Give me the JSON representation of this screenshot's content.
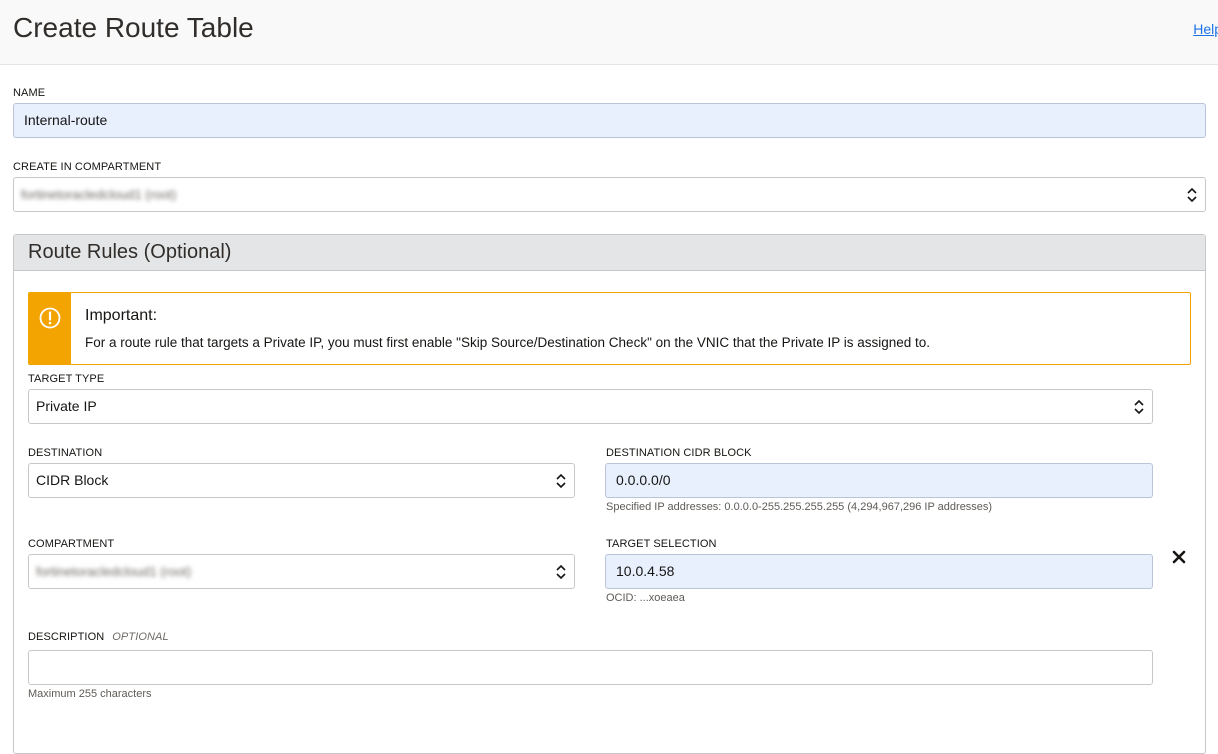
{
  "header": {
    "title": "Create Route Table",
    "help_label": "Help"
  },
  "name": {
    "label": "NAME",
    "value": "Internal-route"
  },
  "compartment": {
    "label": "CREATE IN COMPARTMENT",
    "value": "fortinetoracledcloud1 (root)"
  },
  "route_rules": {
    "title": "Route Rules (Optional)",
    "notice": {
      "icon": "exclamation-circle-icon",
      "heading": "Important:",
      "text": "For a route rule that targets a Private IP, you must first enable \"Skip Source/Destination Check\" on the VNIC that the Private IP is assigned to."
    },
    "target_type": {
      "label": "TARGET TYPE",
      "value": "Private IP"
    },
    "destination": {
      "label": "DESTINATION",
      "value": "CIDR Block"
    },
    "destination_cidr": {
      "label": "DESTINATION CIDR BLOCK",
      "value": "0.0.0.0/0",
      "help": "Specified IP addresses: 0.0.0.0-255.255.255.255 (4,294,967,296 IP addresses)"
    },
    "rule_compartment": {
      "label": "COMPARTMENT",
      "value": "fortinetoracledcloud1 (root)"
    },
    "target_selection": {
      "label": "TARGET SELECTION",
      "value": "10.0.4.58",
      "help": "OCID: ...xoeaea"
    },
    "description": {
      "label": "DESCRIPTION",
      "optional_label": "OPTIONAL",
      "value": "",
      "help": "Maximum 255 characters"
    }
  },
  "colors": {
    "warning": "#f3a400",
    "filled_input": "#e8f0fe",
    "link": "#1a73e8"
  }
}
